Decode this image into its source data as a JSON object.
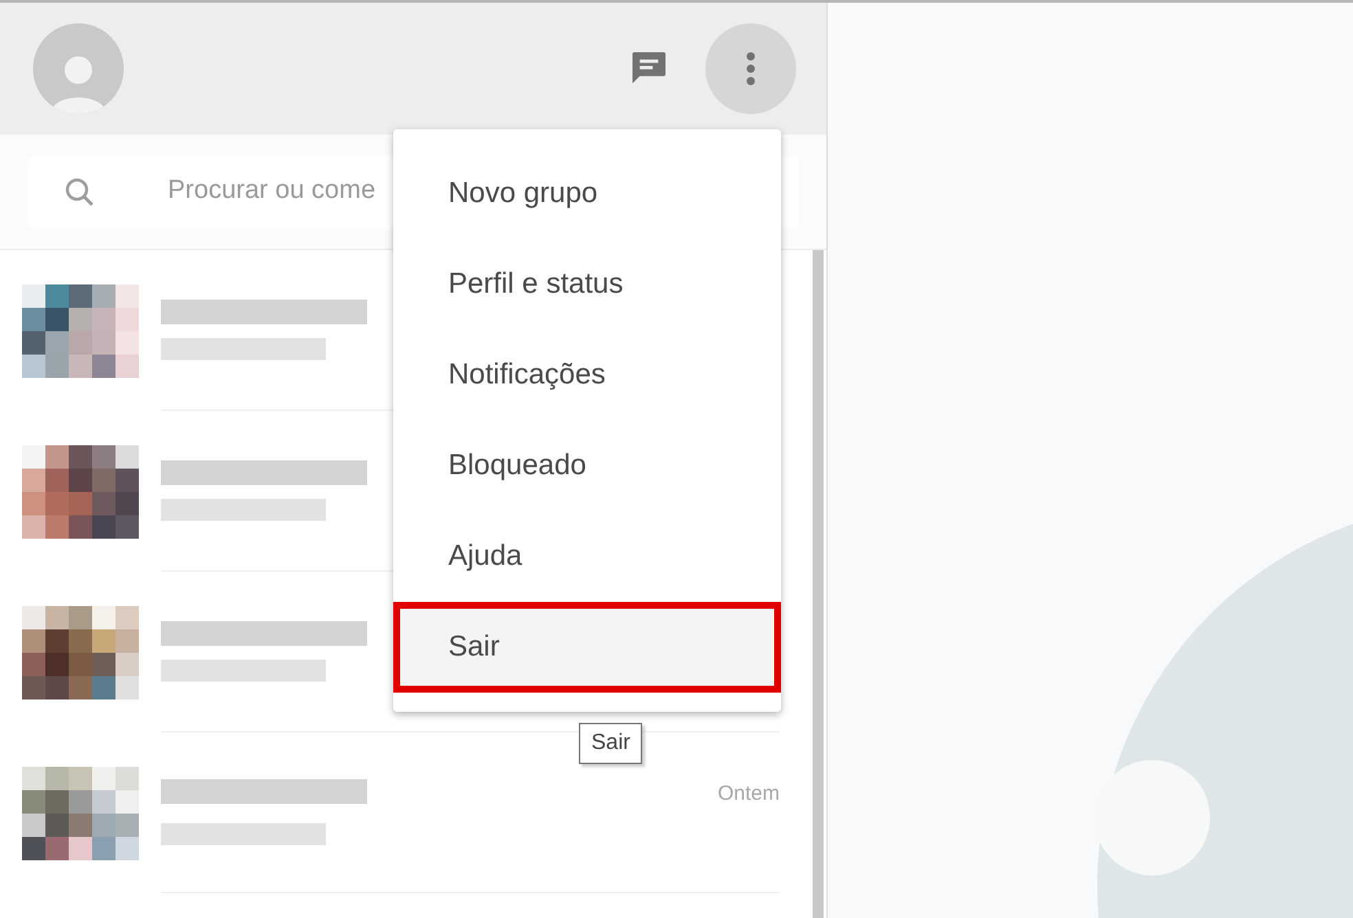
{
  "search": {
    "placeholder": "Procurar ou come"
  },
  "chats": [
    {
      "kind": "blurred"
    },
    {
      "kind": "blurred"
    },
    {
      "kind": "blurred"
    },
    {
      "kind": "blurred",
      "time": "Ontem"
    }
  ],
  "menu": {
    "open": true,
    "items": [
      {
        "label": "Novo grupo",
        "selected": false
      },
      {
        "label": "Perfil e status",
        "selected": false
      },
      {
        "label": "Notificações",
        "selected": false
      },
      {
        "label": "Bloqueado",
        "selected": false
      },
      {
        "label": "Ajuda",
        "selected": false
      },
      {
        "label": "Sair",
        "selected": true
      }
    ]
  },
  "tooltip": "Sair"
}
